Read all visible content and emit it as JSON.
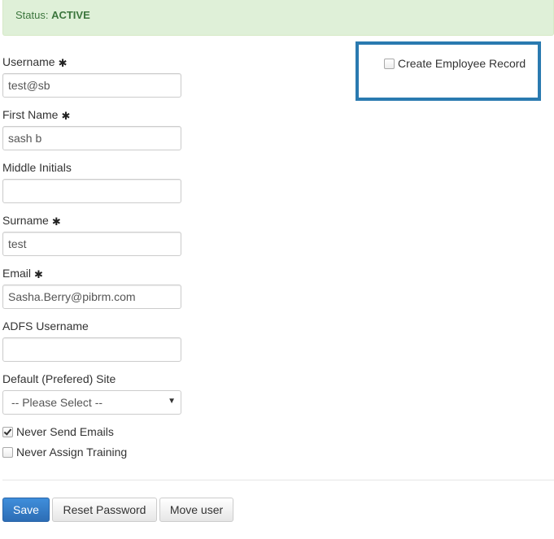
{
  "status": {
    "label": "Status:",
    "value": "ACTIVE"
  },
  "required_marker": "✱",
  "fields": {
    "username": {
      "label": "Username",
      "value": "test@sb"
    },
    "first_name": {
      "label": "First Name",
      "value": "sash b"
    },
    "middle_initials": {
      "label": "Middle Initials",
      "value": ""
    },
    "surname": {
      "label": "Surname",
      "value": "test"
    },
    "email": {
      "label": "Email",
      "value": "Sasha.Berry@pibrm.com"
    },
    "adfs_username": {
      "label": "ADFS Username",
      "value": ""
    },
    "default_site": {
      "label": "Default (Prefered) Site",
      "selected": "-- Please Select --"
    }
  },
  "checkboxes": {
    "never_send_emails": {
      "label": "Never Send Emails",
      "checked": true
    },
    "never_assign_training": {
      "label": "Never Assign Training",
      "checked": false
    },
    "create_employee_record": {
      "label": "Create Employee Record",
      "checked": false
    }
  },
  "buttons": {
    "save": "Save",
    "reset_password": "Reset Password",
    "move_user": "Move user"
  },
  "icons": {
    "required": "asterisk-icon",
    "dropdown": "caret-down-icon"
  },
  "colors": {
    "status_bg": "#dff0d8",
    "status_text": "#3c763d",
    "highlight_border": "#2a7ab0",
    "primary_button": "#337ab7"
  }
}
